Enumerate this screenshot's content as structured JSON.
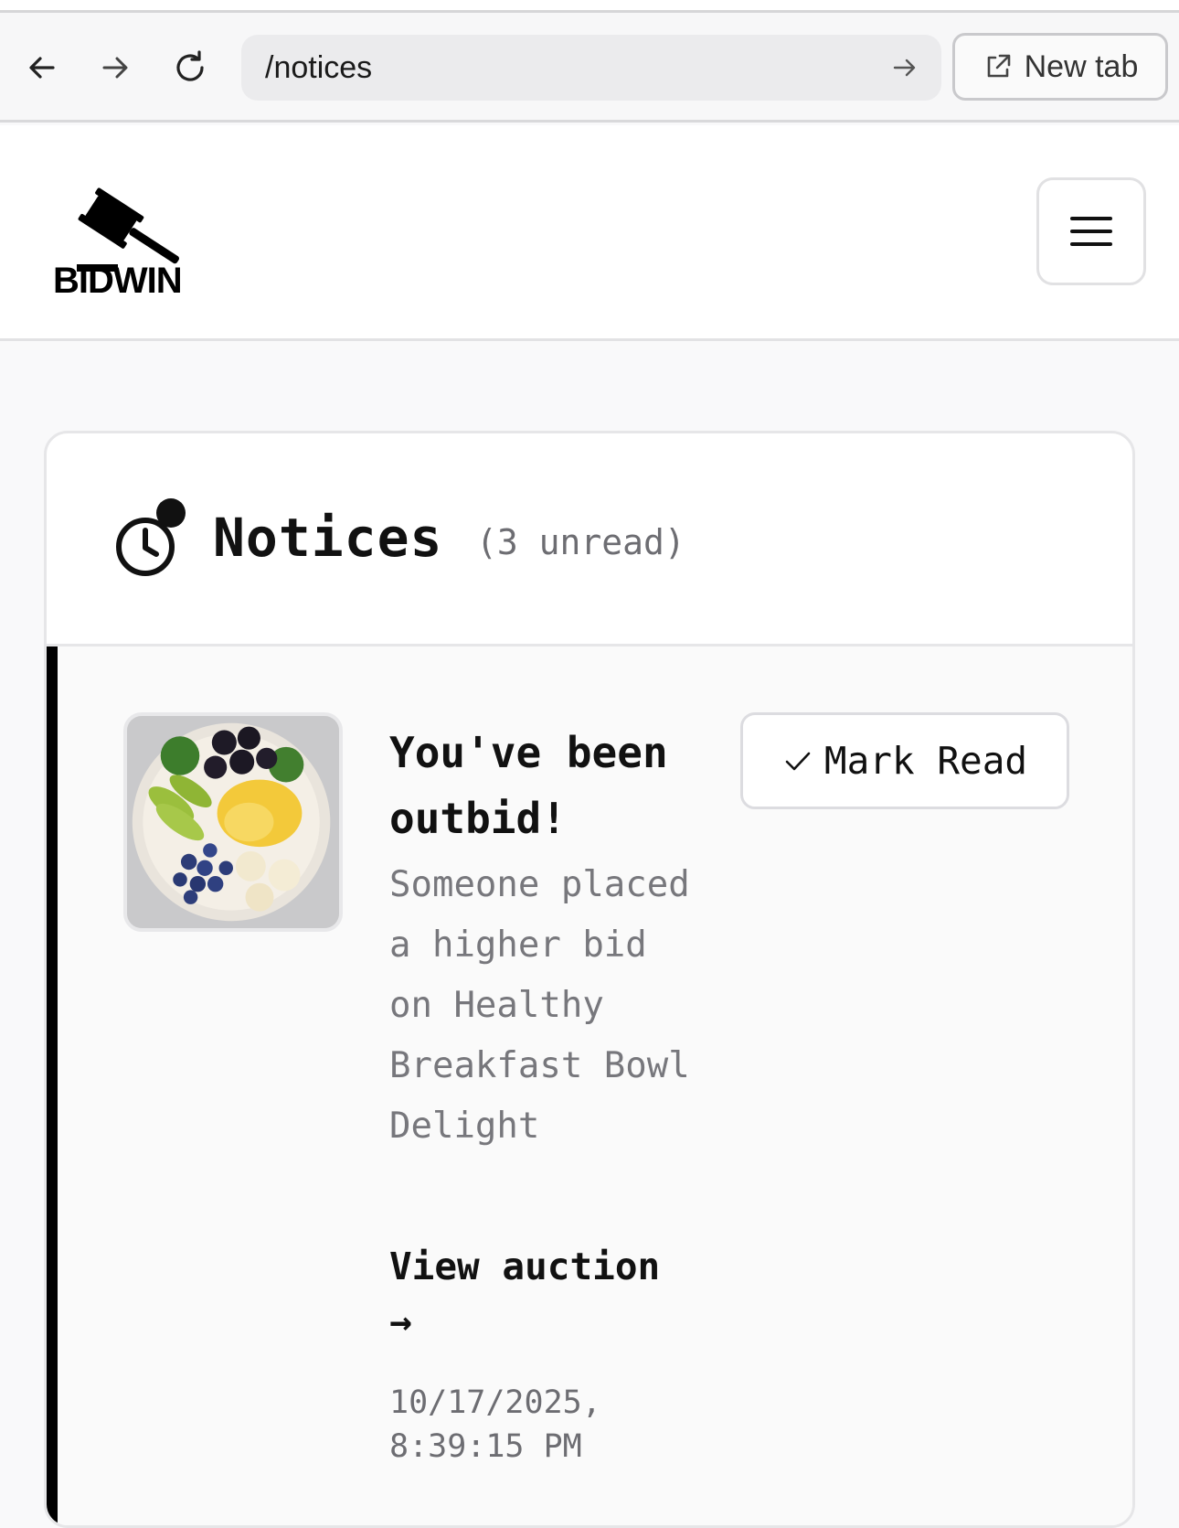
{
  "browser": {
    "url": "/notices",
    "new_tab_label": "New tab",
    "icons": [
      "back-arrow-icon",
      "forward-arrow-icon",
      "reload-icon",
      "go-arrow-icon",
      "external-link-icon"
    ]
  },
  "header": {
    "logo_text": "BIDWIN",
    "menu_icon": "hamburger-menu-icon"
  },
  "notices": {
    "title": "Notices",
    "unread_label": "(3 unread)",
    "items": [
      {
        "title": "You've been outbid!",
        "body": "Someone placed a higher bid on Healthy Breakfast Bowl Delight",
        "link_label": "View auction",
        "link_arrow": "→",
        "timestamp": "10/17/2025, 8:39:15 PM",
        "mark_read_label": "Mark Read",
        "unread": true
      }
    ]
  },
  "colors": {
    "accent": "#000000",
    "muted_text": "#77777c",
    "border": "#e6e6e8"
  }
}
